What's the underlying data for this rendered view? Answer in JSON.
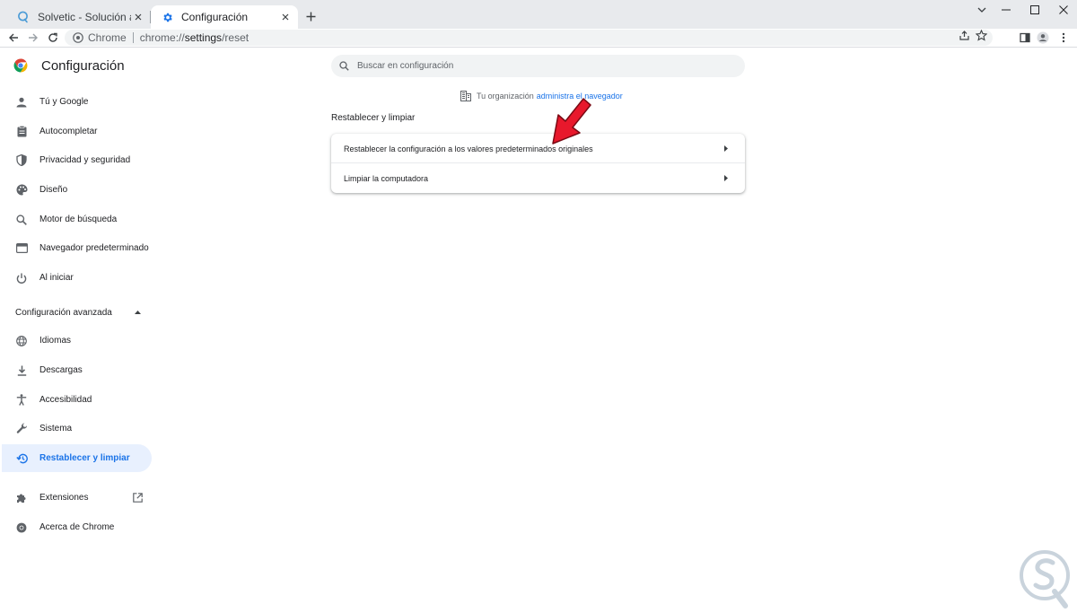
{
  "tabs": [
    {
      "title": "Solvetic - Solución a los problem",
      "active": false,
      "icon": "solvetic-favicon"
    },
    {
      "title": "Configuración",
      "active": true,
      "icon": "settings-gear-icon"
    }
  ],
  "toolbar": {
    "chip_label": "Chrome",
    "url_scheme": "chrome://",
    "url_host": "settings",
    "url_path": "/reset"
  },
  "header": {
    "title": "Configuración",
    "search_placeholder": "Buscar en configuración"
  },
  "sidebar": {
    "items": [
      {
        "label": "Tú y Google",
        "icon": "person-icon"
      },
      {
        "label": "Autocompletar",
        "icon": "clipboard-icon"
      },
      {
        "label": "Privacidad y seguridad",
        "icon": "shield-icon"
      },
      {
        "label": "Diseño",
        "icon": "palette-icon"
      },
      {
        "label": "Motor de búsqueda",
        "icon": "search-icon"
      },
      {
        "label": "Navegador predeterminado",
        "icon": "browser-icon"
      },
      {
        "label": "Al iniciar",
        "icon": "power-icon"
      }
    ],
    "advanced_label": "Configuración avanzada",
    "advanced_items": [
      {
        "label": "Idiomas",
        "icon": "globe-icon"
      },
      {
        "label": "Descargas",
        "icon": "download-icon"
      },
      {
        "label": "Accesibilidad",
        "icon": "accessibility-icon"
      },
      {
        "label": "Sistema",
        "icon": "wrench-icon"
      },
      {
        "label": "Restablecer y limpiar",
        "icon": "restore-icon",
        "selected": true
      }
    ],
    "extra_items": [
      {
        "label": "Extensiones",
        "icon": "puzzle-icon"
      },
      {
        "label": "Acerca de Chrome",
        "icon": "chrome-icon"
      }
    ]
  },
  "main": {
    "managed_text": "Tu organización",
    "managed_link": "administra el navegador",
    "section_title": "Restablecer y limpiar",
    "rows": [
      {
        "label": "Restablecer la configuración a los valores predeterminados originales"
      },
      {
        "label": "Limpiar la computadora"
      }
    ]
  },
  "colors": {
    "accent": "#1a73e8",
    "selected_bg": "#e8f0fe",
    "pointer": "#e8182c",
    "tabstrip": "#e8eaed"
  }
}
